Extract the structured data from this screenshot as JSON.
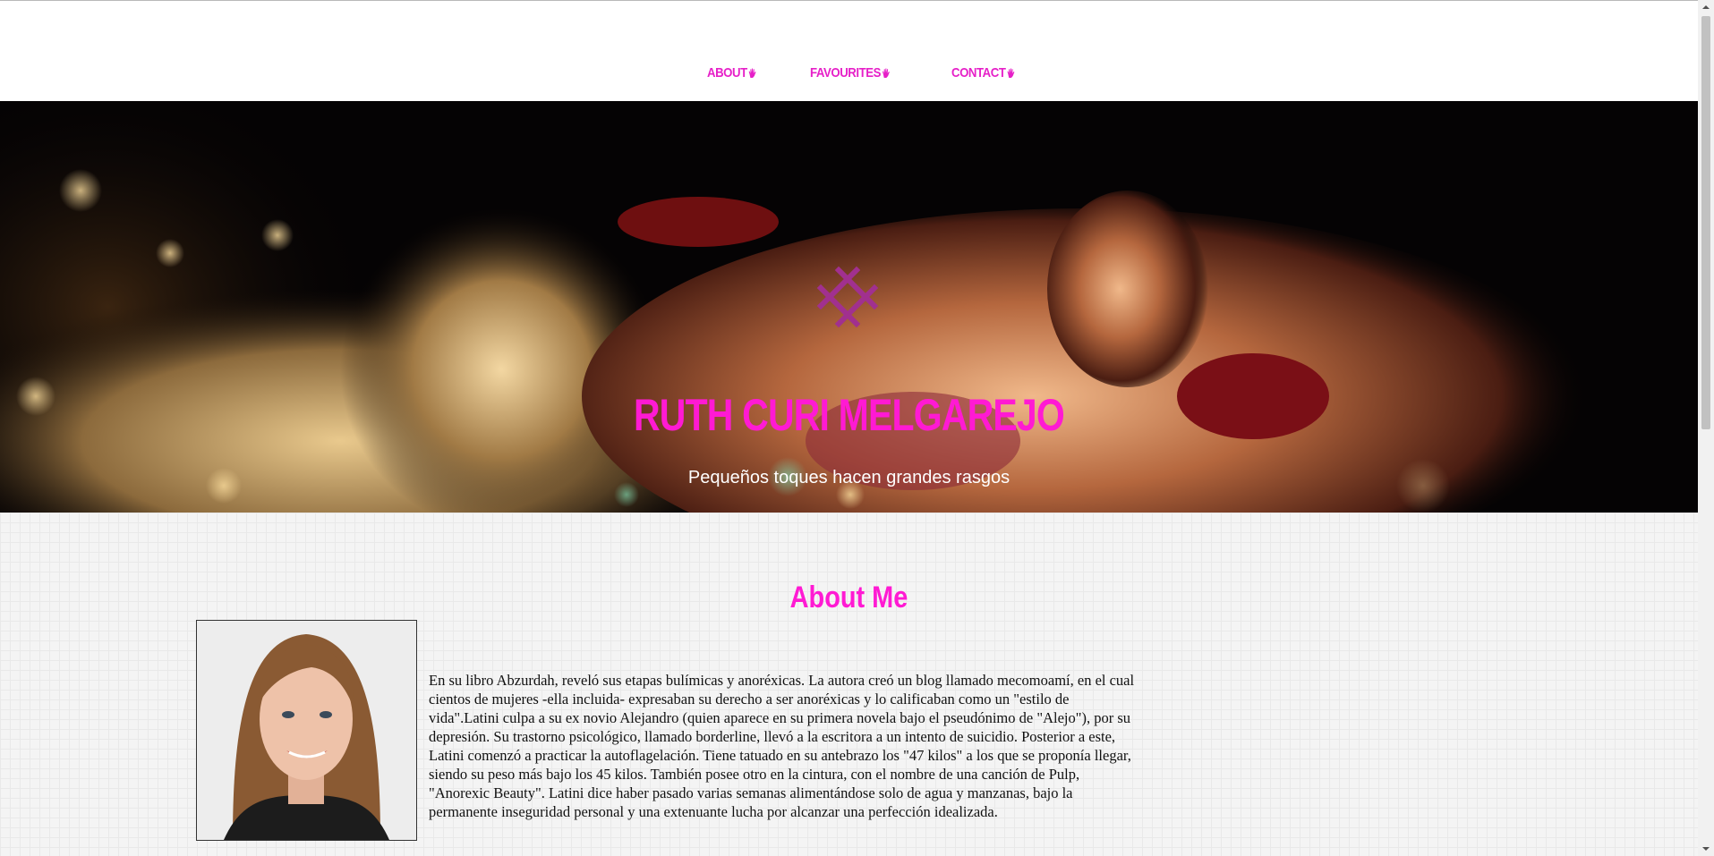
{
  "nav": {
    "items": [
      {
        "label": "ABOUT"
      },
      {
        "label": "FAVOURITES"
      },
      {
        "label": "CONTACT"
      }
    ],
    "accent": "#e620c8"
  },
  "hero": {
    "title": "RUTH CURI MELGAREJO",
    "subtitle": "Pequeños toques hacen grandes rasgos",
    "title_color": "#ff1ad3",
    "logo_icon": "woven-cross-icon",
    "logo_color": "#a1308f"
  },
  "about": {
    "title": "About Me",
    "text": "En su libro Abzurdah, reveló sus etapas bulímicas y anoréxicas. La autora creó un blog llamado mecomoamí, en el cual cientos de mujeres -ella incluida- expresaban su derecho a ser anoréxicas y lo calificaban como un \"estilo de vida\".Latini culpa a su ex novio Alejandro (quien aparece en su primera novela bajo el pseudónimo de \"Alejo\"), por su depresión. Su trastorno psicológico, llamado borderline, llevó a la escritora a un intento de suicidio. Posterior a este, Latini comenzó a practicar la autoflagelación. Tiene tatuado en su antebrazo los \"47 kilos\" a los que se proponía llegar, siendo su peso más bajo los 45 kilos. También posee otro en la cintura, con el nombre de una canción de Pulp, \"Anorexic Beauty\". Latini dice haber pasado varias semanas alimentándose solo de agua y manzanas, bajo la permanente inseguridad personal y una extenuante lucha por alcanzar una perfección idealizada."
  }
}
